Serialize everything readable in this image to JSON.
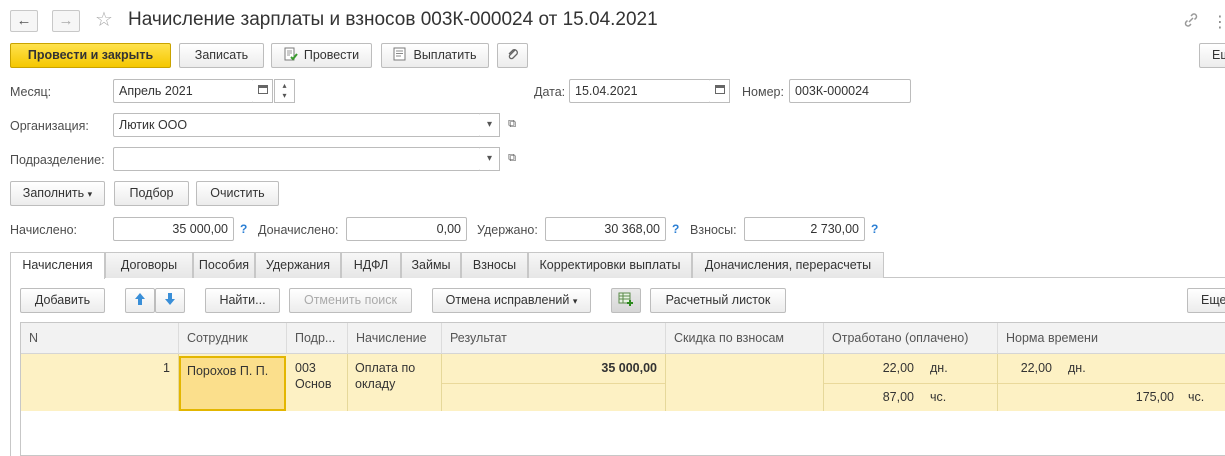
{
  "window": {
    "title": "Начисление зарплаты и взносов 003К-000024 от 15.04.2021",
    "back_icon": "←",
    "forward_icon": "→",
    "star_icon": "☆",
    "link_icon": "🔗",
    "more_icon": "⋮"
  },
  "toolbar": {
    "post_close": "Провести и закрыть",
    "save": "Записать",
    "post": "Провести",
    "pay": "Выплатить",
    "attach_icon": "📎",
    "more": "Еш"
  },
  "form": {
    "month_label": "Месяц:",
    "month_value": "Апрель 2021",
    "date_label": "Дата:",
    "date_value": "15.04.2021",
    "number_label": "Номер:",
    "number_value": "003К-000024",
    "org_label": "Организация:",
    "org_value": "Лютик ООО",
    "dept_label": "Подразделение:",
    "dept_value": ""
  },
  "actions": {
    "fill": "Заполнить",
    "select": "Подбор",
    "clear": "Очистить"
  },
  "totals": {
    "accrued_label": "Начислено:",
    "accrued_value": "35 000,00",
    "extra_label": "Доначислено:",
    "extra_value": "0,00",
    "withheld_label": "Удержано:",
    "withheld_value": "30 368,00",
    "contrib_label": "Взносы:",
    "contrib_value": "2 730,00",
    "help_mark": "?"
  },
  "tabs": [
    "Начисления",
    "Договоры",
    "Пособия",
    "Удержания",
    "НДФЛ",
    "Займы",
    "Взносы",
    "Корректировки выплаты",
    "Доначисления, перерасчеты"
  ],
  "grid_toolbar": {
    "add": "Добавить",
    "find": "Найти...",
    "cancel_search": "Отменить поиск",
    "cancel_fixes": "Отмена исправлений",
    "payslip": "Расчетный листок",
    "more": "Еще"
  },
  "grid": {
    "columns": [
      "N",
      "Сотрудник",
      "Подр...",
      "Начисление",
      "Результат",
      "Скидка по взносам",
      "Отработано (оплачено)",
      "Норма времени"
    ],
    "row": {
      "n": "1",
      "employee": "Порохов П. П.",
      "dept_line1": "003",
      "dept_line2": "Основ",
      "accrual": "Оплата по окладу",
      "result": "35 000,00",
      "worked_days": "22,00",
      "days_unit": "дн.",
      "worked_hours": "87,00",
      "hours_unit": "чс.",
      "norm_days": "22,00",
      "norm_days_unit": "дн.",
      "norm_hours": "175,00",
      "norm_hours_unit": "чс."
    }
  }
}
